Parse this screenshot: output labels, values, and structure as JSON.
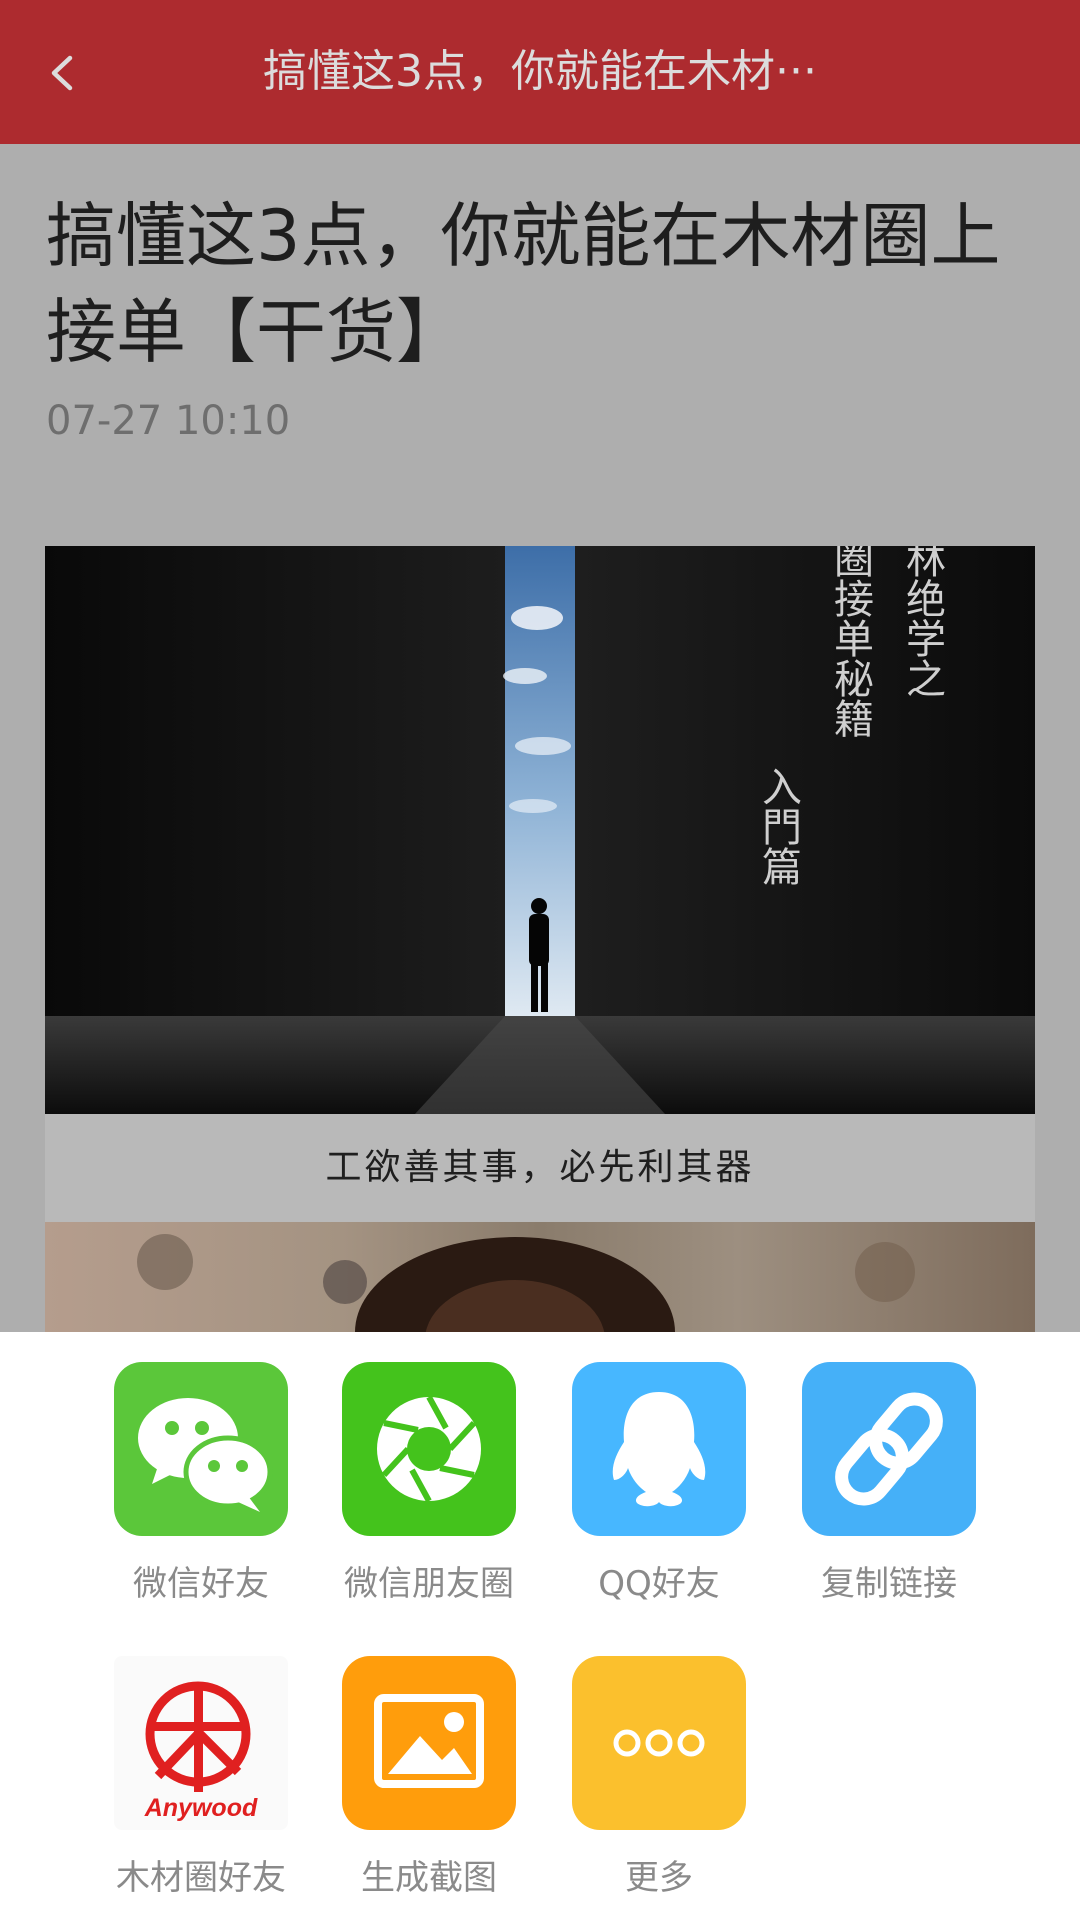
{
  "header": {
    "title": "搞懂这3点，你就能在木材···",
    "back_icon": "chevron-left-icon",
    "background": "#ad2b2f"
  },
  "article": {
    "headline": "搞懂这3点，你就能在木材圈上接单【干货】",
    "date": "07-27 10:10",
    "image_caption": "工欲善其事，必先利其器",
    "hero_calligraphy": {
      "column_1": "武林绝学之",
      "column_2": "木材圈接单秘籍",
      "column_3": "入門篇"
    }
  },
  "share": {
    "items": [
      {
        "label": "微信好友",
        "icon": "wechat-icon",
        "color": "#5bc73a"
      },
      {
        "label": "微信朋友圈",
        "icon": "wechat-moments-icon",
        "color": "#44c31c"
      },
      {
        "label": "QQ好友",
        "icon": "qq-icon",
        "color": "#47b7ff"
      },
      {
        "label": "复制链接",
        "icon": "link-icon",
        "color": "#45b0f8"
      },
      {
        "label": "木材圈好友",
        "icon": "anywood-logo-icon",
        "color": "#e02020",
        "logo_text": "Anywood"
      },
      {
        "label": "生成截图",
        "icon": "image-icon",
        "color": "#ff9d0c"
      },
      {
        "label": "更多",
        "icon": "more-dots-icon",
        "color": "#fbc02d"
      }
    ]
  }
}
